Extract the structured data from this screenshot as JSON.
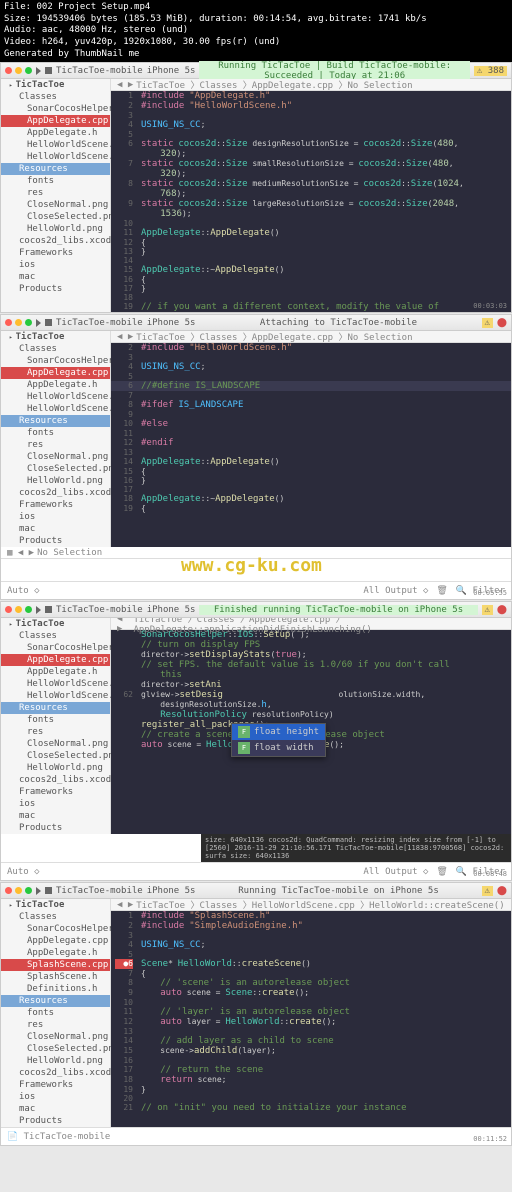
{
  "fileinfo": {
    "l1": "File: 002 Project Setup.mp4",
    "l2": "Size: 194539406 bytes (185.53 MiB), duration: 00:14:54, avg.bitrate: 1741 kb/s",
    "l3": "Audio: aac, 48000 Hz, stereo (und)",
    "l4": "Video: h264, yuv420p, 1920x1080, 30.00 fps(r) (und)",
    "l5": "Generated by ThumbNail me"
  },
  "scheme": "TicTacToe-mobile",
  "device": "iPhone 5s",
  "status1": "Running TicTacToe   |  Build TicTacToe-mobile: Succeeded   |   Today at 21:06",
  "warn1": "388",
  "crumb1": "TicTacToe 〉Classes 〉AppDelegate.cpp 〉No Selection",
  "sidebar": [
    {
      "t": "TicTacToe",
      "c": "l1"
    },
    {
      "t": "Classes",
      "c": "l2"
    },
    {
      "t": "SonarCocosHelperCPP",
      "c": "l3"
    },
    {
      "t": "AppDelegate.cpp",
      "c": "l3 sel"
    },
    {
      "t": "AppDelegate.h",
      "c": "l3"
    },
    {
      "t": "HelloWorldScene.cpp",
      "c": "l3"
    },
    {
      "t": "HelloWorldScene.h",
      "c": "l3"
    },
    {
      "t": "Resources",
      "c": "sb-folder"
    },
    {
      "t": "fonts",
      "c": "l3"
    },
    {
      "t": "res",
      "c": "l3"
    },
    {
      "t": "CloseNormal.png",
      "c": "l3"
    },
    {
      "t": "CloseSelected.png",
      "c": "l3"
    },
    {
      "t": "HelloWorld.png",
      "c": "l3"
    },
    {
      "t": "cocos2d_libs.xcodeproj",
      "c": "l2"
    },
    {
      "t": "Frameworks",
      "c": "l2"
    },
    {
      "t": "ios",
      "c": "l2"
    },
    {
      "t": "mac",
      "c": "l2"
    },
    {
      "t": "Products",
      "c": "l2"
    }
  ],
  "code1": [
    {
      "n": "1",
      "h": "<span class='kw'>#include</span> <span class='st'>\"AppDelegate.h\"</span>"
    },
    {
      "n": "2",
      "h": "<span class='kw'>#include</span> <span class='st'>\"HelloWorldScene.h\"</span>"
    },
    {
      "n": "3",
      "h": ""
    },
    {
      "n": "4",
      "h": "<span class='bl'>USING_NS_CC</span>;"
    },
    {
      "n": "5",
      "h": ""
    },
    {
      "n": "6",
      "h": "<span class='kw'>static</span> <span class='ty'>cocos2d</span>::<span class='ty'>Size</span> designResolutionSize = <span class='ty'>cocos2d</span>::<span class='ty'>Size</span>(<span class='nm'>480</span>,"
    },
    {
      "n": "",
      "h": "    <span class='nm'>320</span>);"
    },
    {
      "n": "7",
      "h": "<span class='kw'>static</span> <span class='ty'>cocos2d</span>::<span class='ty'>Size</span> smallResolutionSize = <span class='ty'>cocos2d</span>::<span class='ty'>Size</span>(<span class='nm'>480</span>,"
    },
    {
      "n": "",
      "h": "    <span class='nm'>320</span>);"
    },
    {
      "n": "8",
      "h": "<span class='kw'>static</span> <span class='ty'>cocos2d</span>::<span class='ty'>Size</span> mediumResolutionSize = <span class='ty'>cocos2d</span>::<span class='ty'>Size</span>(<span class='nm'>1024</span>,"
    },
    {
      "n": "",
      "h": "    <span class='nm'>768</span>);"
    },
    {
      "n": "9",
      "h": "<span class='kw'>static</span> <span class='ty'>cocos2d</span>::<span class='ty'>Size</span> largeResolutionSize = <span class='ty'>cocos2d</span>::<span class='ty'>Size</span>(<span class='nm'>2048</span>,"
    },
    {
      "n": "",
      "h": "    <span class='nm'>1536</span>);"
    },
    {
      "n": "10",
      "h": ""
    },
    {
      "n": "11",
      "h": "<span class='ty'>AppDelegate</span>::<span class='fn'>AppDelegate</span>()"
    },
    {
      "n": "12",
      "h": "{"
    },
    {
      "n": "13",
      "h": "}"
    },
    {
      "n": "14",
      "h": ""
    },
    {
      "n": "15",
      "h": "<span class='ty'>AppDelegate</span>::~<span class='fn'>AppDelegate</span>()"
    },
    {
      "n": "16",
      "h": "{"
    },
    {
      "n": "17",
      "h": "}"
    },
    {
      "n": "18",
      "h": ""
    },
    {
      "n": "19",
      "h": "<span class='cm'>// if you want a different context, modify the value of</span>"
    }
  ],
  "ts1": "00:03:03",
  "status2": "Attaching to TicTacToe-mobile",
  "crumb2": "TicTacToe 〉Classes 〉AppDelegate.cpp 〉No Selection",
  "code2": [
    {
      "n": "2",
      "h": "<span class='kw'>#include</span> <span class='st'>\"HelloWorldScene.h\"</span>"
    },
    {
      "n": "3",
      "h": ""
    },
    {
      "n": "4",
      "h": "<span class='bl'>USING_NS_CC</span>;"
    },
    {
      "n": "5",
      "h": ""
    },
    {
      "n": "6",
      "h": "<span class='cm'>//#define IS_LANDSCAPE</span>",
      "hl": true
    },
    {
      "n": "7",
      "h": ""
    },
    {
      "n": "8",
      "h": "<span class='kw'>#ifdef</span> <span class='bl'>IS_LANDSCAPE</span>"
    },
    {
      "n": "9",
      "h": ""
    },
    {
      "n": "10",
      "h": "<span class='kw'>#else</span>"
    },
    {
      "n": "11",
      "h": ""
    },
    {
      "n": "12",
      "h": "<span class='kw'>#endif</span>"
    },
    {
      "n": "13",
      "h": ""
    },
    {
      "n": "14",
      "h": "<span class='ty'>AppDelegate</span>::<span class='fn'>AppDelegate</span>()"
    },
    {
      "n": "15",
      "h": "{"
    },
    {
      "n": "16",
      "h": "}"
    },
    {
      "n": "17",
      "h": ""
    },
    {
      "n": "18",
      "h": "<span class='ty'>AppDelegate</span>::~<span class='fn'>AppDelegate</span>()"
    },
    {
      "n": "19",
      "h": "{"
    }
  ],
  "watermark": "www.cg-ku.com",
  "crumb2b": "No Selection",
  "bottombar": {
    "auto": "Auto ◇",
    "output": "All Output ◇",
    "filter": "Filter"
  },
  "ts2": "00:05:55",
  "status3": "Finished running TicTacToe-mobile on iPhone 5s",
  "crumb3": "TicTacToe 〉Classes 〉AppDelegate.cpp 〉AppDelegate::applicationDidFinishLaunching()",
  "code3": [
    {
      "n": "",
      "h": "<span class='ty'>SonarCocosHelper</span>::<span class='ty'>IOS</span>::<span class='fn'>Setup</span>( );"
    },
    {
      "n": "",
      "h": ""
    },
    {
      "n": "",
      "h": "<span class='cm'>// turn on display FPS</span>"
    },
    {
      "n": "",
      "h": "director-><span class='fn'>setDisplayStats</span>(<span class='kw'>true</span>);"
    },
    {
      "n": "",
      "h": ""
    },
    {
      "n": "",
      "h": "<span class='cm'>// set FPS. the default value is 1.0/60 if you don't call</span>"
    },
    {
      "n": "",
      "h": "    <span class='cm'>this</span>"
    },
    {
      "n": "",
      "h": "director-><span class='fn'>setAni</span>"
    },
    {
      "n": "",
      "h": ""
    },
    {
      "n": "62",
      "h": "glview-><span class='fn'>setDesig</span>                        olutionSize.width,"
    },
    {
      "n": "",
      "h": "    designResolutionSize.<span class='bl'>h</span>,"
    },
    {
      "n": "",
      "h": "    <span class='ty'>ResolutionPolicy</span> resolutionPolicy)"
    },
    {
      "n": "",
      "h": ""
    },
    {
      "n": "",
      "h": "<span class='fn'>register_all_packages</span>();"
    },
    {
      "n": "",
      "h": ""
    },
    {
      "n": "",
      "h": "<span class='cm'>// create a scene. it's an autorelease object</span>"
    },
    {
      "n": "",
      "h": "<span class='kw'>auto</span> scene = <span class='ty'>HelloWorld</span>::<span class='fn'>createScene</span>();"
    }
  ],
  "autocomplete": [
    {
      "t": "float height",
      "sel": true
    },
    {
      "t": "float width",
      "sel": false
    }
  ],
  "console": "size: 640x1136\n cocos2d: QuadCommand: resizing index size from [-1] to [2560]\n 2016-11-29 21:10:56.171 TicTacToe-mobile[11838:9700568] cocos2d: surfa\n size: 640x1136",
  "ts3": "00:08:48",
  "status4": "Running TicTacToe-mobile on iPhone 5s",
  "crumb4": "TicTacToe 〉Classes 〉HelloWorldScene.cpp 〉HelloWorld::createScene()",
  "sidebar4": [
    {
      "t": "TicTacToe",
      "c": "l1"
    },
    {
      "t": "Classes",
      "c": "l2"
    },
    {
      "t": "SonarCocosHelperCPP",
      "c": "l3"
    },
    {
      "t": "AppDelegate.cpp",
      "c": "l3"
    },
    {
      "t": "AppDelegate.h",
      "c": "l3"
    },
    {
      "t": "SplashScene.cpp",
      "c": "l3 sel"
    },
    {
      "t": "SplashScene.h",
      "c": "l3"
    },
    {
      "t": "Definitions.h",
      "c": "l3"
    },
    {
      "t": "Resources",
      "c": "sb-folder"
    },
    {
      "t": "fonts",
      "c": "l3"
    },
    {
      "t": "res",
      "c": "l3"
    },
    {
      "t": "CloseNormal.png",
      "c": "l3"
    },
    {
      "t": "CloseSelected.png",
      "c": "l3"
    },
    {
      "t": "HelloWorld.png",
      "c": "l3"
    },
    {
      "t": "cocos2d_libs.xcodeproj",
      "c": "l2"
    },
    {
      "t": "Frameworks",
      "c": "l2"
    },
    {
      "t": "ios",
      "c": "l2"
    },
    {
      "t": "mac",
      "c": "l2"
    },
    {
      "t": "Products",
      "c": "l2"
    }
  ],
  "code4": [
    {
      "n": "1",
      "h": "<span class='kw'>#include</span> <span class='st'>\"SplashScene.h\"</span>"
    },
    {
      "n": "2",
      "h": "<span class='kw'>#include</span> <span class='st'>\"SimpleAudioEngine.h\"</span>"
    },
    {
      "n": "3",
      "h": ""
    },
    {
      "n": "4",
      "h": "<span class='bl'>USING_NS_CC</span>;"
    },
    {
      "n": "5",
      "h": ""
    },
    {
      "n": "6",
      "h": "<span class='ty'>Scene</span>* <span class='ty'>HelloWorld</span>::<span class='fn'>createScene</span>()",
      "err": true
    },
    {
      "n": "7",
      "h": "{"
    },
    {
      "n": "8",
      "h": "    <span class='cm'>// 'scene' is an autorelease object</span>"
    },
    {
      "n": "9",
      "h": "    <span class='kw'>auto</span> scene = <span class='ty'>Scene</span>::<span class='fn'>create</span>();"
    },
    {
      "n": "10",
      "h": ""
    },
    {
      "n": "11",
      "h": "    <span class='cm'>// 'layer' is an autorelease object</span>"
    },
    {
      "n": "12",
      "h": "    <span class='kw'>auto</span> layer = <span class='ty'>HelloWorld</span>::<span class='fn'>create</span>();"
    },
    {
      "n": "13",
      "h": ""
    },
    {
      "n": "14",
      "h": "    <span class='cm'>// add layer as a child to scene</span>"
    },
    {
      "n": "15",
      "h": "    scene-><span class='fn'>addChild</span>(layer);"
    },
    {
      "n": "16",
      "h": ""
    },
    {
      "n": "17",
      "h": "    <span class='cm'>// return the scene</span>"
    },
    {
      "n": "18",
      "h": "    <span class='kw'>return</span> scene;"
    },
    {
      "n": "19",
      "h": "}"
    },
    {
      "n": "20",
      "h": ""
    },
    {
      "n": "21",
      "h": "<span class='cm'>// on \"init\" you need to initialize your instance</span>"
    }
  ],
  "tabbar": "TicTacToe-mobile",
  "ts4": "00:11:52"
}
